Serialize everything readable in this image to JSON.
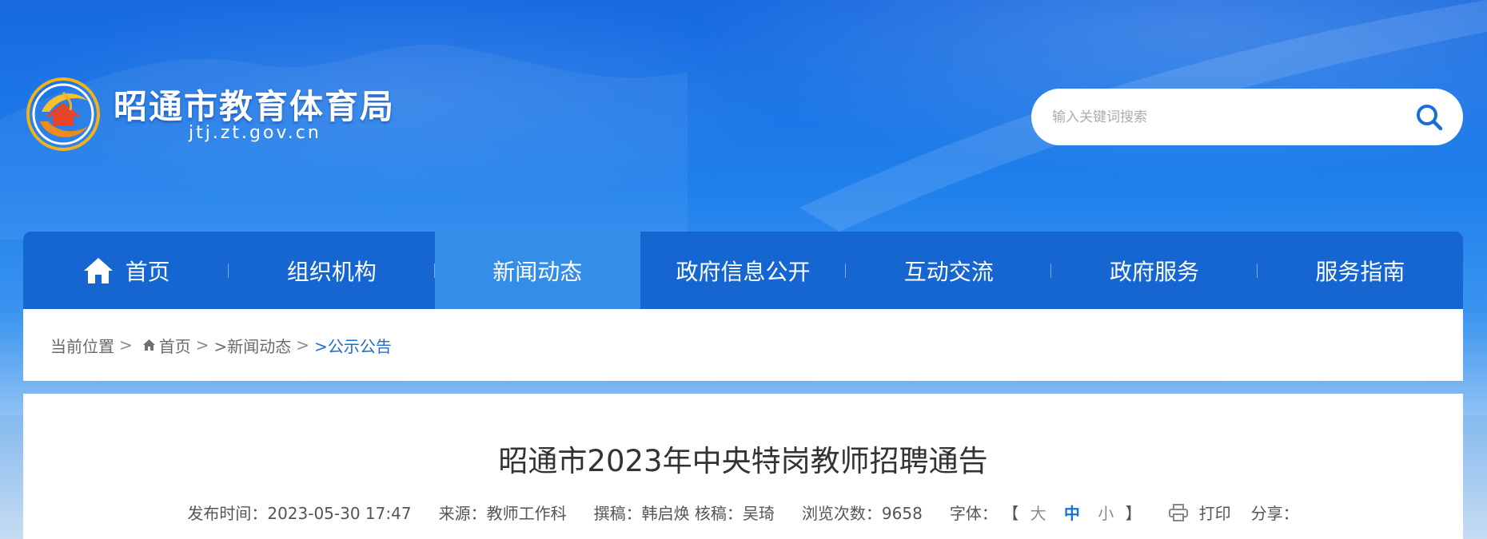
{
  "header": {
    "site_name": "昭通市教育体育局",
    "site_domain": "jtj.zt.gov.cn",
    "logo_icon": "bureau-emblem-icon",
    "search": {
      "placeholder": "输入关键词搜索",
      "icon": "search-icon"
    }
  },
  "nav": {
    "items": [
      {
        "label": "首页",
        "icon": "home-icon"
      },
      {
        "label": "组织机构"
      },
      {
        "label": "新闻动态",
        "active": true
      },
      {
        "label": "政府信息公开"
      },
      {
        "label": "互动交流"
      },
      {
        "label": "政府服务"
      },
      {
        "label": "服务指南"
      }
    ]
  },
  "breadcrumb": {
    "prefix": "当前位置",
    "home": "首页",
    "level1": ">新闻动态",
    "current": ">公示公告",
    "chevron": ">"
  },
  "article": {
    "title": "昭通市2023年中央特岗教师招聘通告",
    "publish_time": "发布时间：2023-05-30 17:47",
    "source": "来源：教师工作科",
    "author": "撰稿：韩启焕 核稿：吴琦",
    "views": "浏览次数：9658",
    "font_size": {
      "label": "字体：",
      "open_bracket": "【",
      "large": "大",
      "medium": "中",
      "small": "小",
      "close_bracket": "】"
    },
    "print": "打印",
    "share": "分享："
  },
  "colors": {
    "nav_bg": "#1666d2",
    "nav_active": "#348ee8",
    "link_blue": "#1a6fd6"
  }
}
